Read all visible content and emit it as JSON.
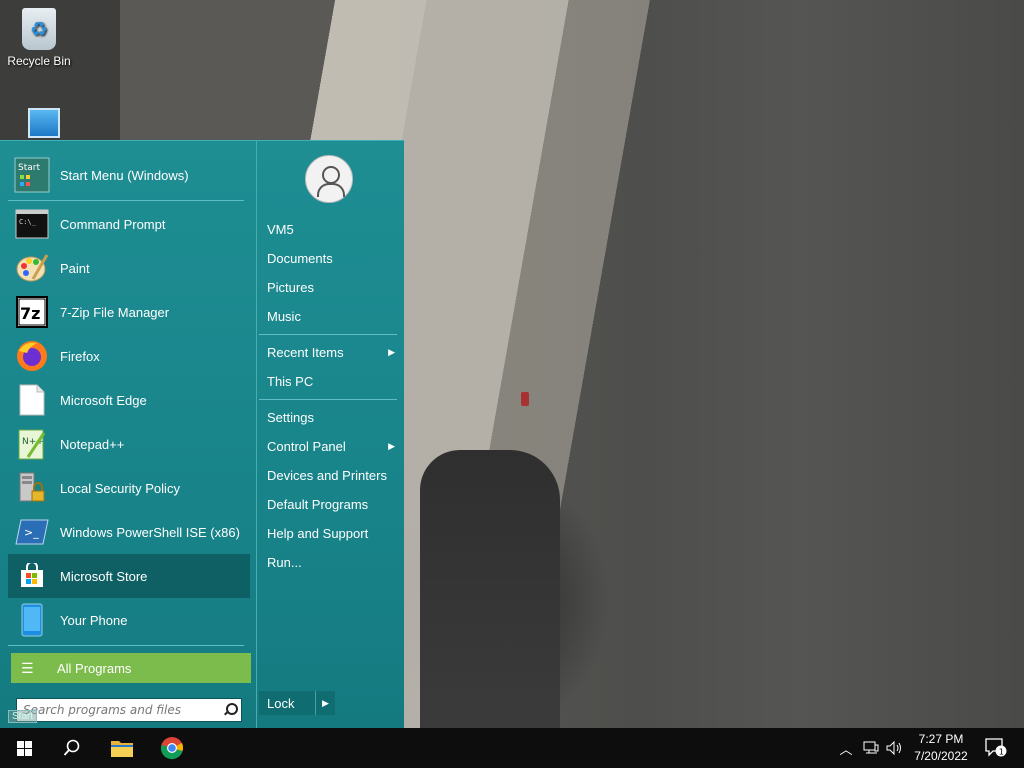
{
  "desktop": {
    "recycle_bin_label": "Recycle Bin"
  },
  "start_menu": {
    "pinned": {
      "label": "Start Menu (Windows)",
      "icon": "start-menu-icon"
    },
    "apps": [
      {
        "label": "Command Prompt",
        "icon": "command-prompt-icon"
      },
      {
        "label": "Paint",
        "icon": "paint-icon"
      },
      {
        "label": "7-Zip File Manager",
        "icon": "7zip-icon"
      },
      {
        "label": "Firefox",
        "icon": "firefox-icon"
      },
      {
        "label": "Microsoft Edge",
        "icon": "edge-icon"
      },
      {
        "label": "Notepad++",
        "icon": "notepadpp-icon"
      },
      {
        "label": "Local Security Policy",
        "icon": "security-policy-icon"
      },
      {
        "label": "Windows PowerShell ISE (x86)",
        "icon": "powershell-ise-icon"
      },
      {
        "label": "Microsoft Store",
        "icon": "store-icon"
      },
      {
        "label": "Your Phone",
        "icon": "phone-icon"
      }
    ],
    "all_programs_label": "All Programs",
    "search_placeholder": "Search programs and files",
    "start_icon_text": "Start",
    "places": {
      "user": "VM5",
      "documents": "Documents",
      "pictures": "Pictures",
      "music": "Music",
      "recent_items": "Recent Items",
      "this_pc": "This PC",
      "settings": "Settings",
      "control_panel": "Control Panel",
      "devices_printers": "Devices and Printers",
      "default_programs": "Default Programs",
      "help_support": "Help and Support",
      "run": "Run..."
    },
    "lock_label": "Lock",
    "start_tooltip": "Start"
  },
  "taskbar": {
    "time": "7:27 PM",
    "date": "7/20/2022",
    "notification_count": "1"
  },
  "colors": {
    "menu_bg": "#1e8e93",
    "all_programs_green": "#7cbc4c",
    "taskbar": "#0d0d0d"
  }
}
